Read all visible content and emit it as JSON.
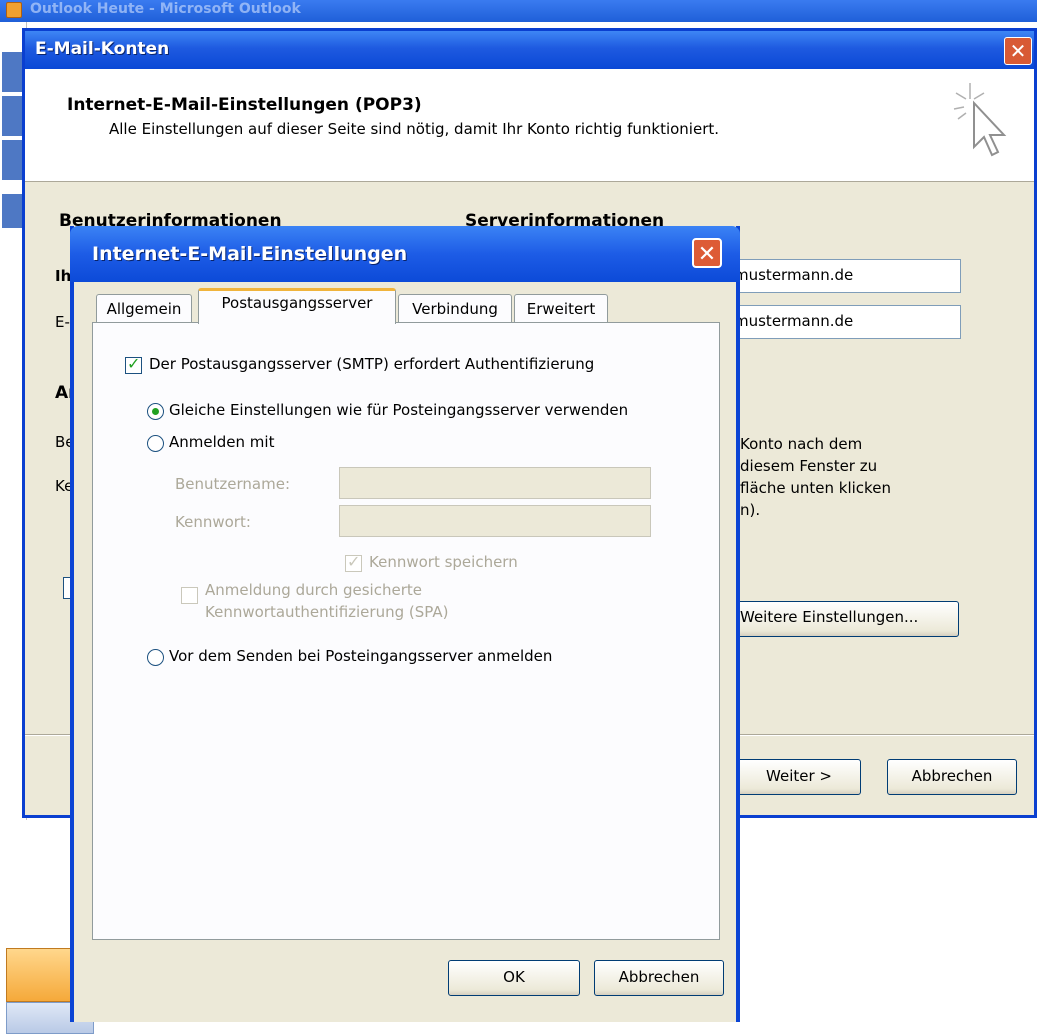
{
  "outlook": {
    "title": "Outlook Heute - Microsoft Outlook"
  },
  "email_accounts": {
    "title": "E-Mail-Konten",
    "header_title": "Internet-E-Mail-Einstellungen (POP3)",
    "header_subtitle": "Alle Einstellungen auf dieser Seite sind nötig, damit Ihr Konto richtig funktioniert.",
    "section_user": "Benutzerinformationen",
    "section_server": "Serverinformationen",
    "section_login_partial": "An",
    "label_name_partial": "Ih",
    "label_email_partial": "E-",
    "label_user_partial": "Be",
    "label_pw_partial": "Ke",
    "server_field_1": "mustermann.de",
    "server_field_2": "mustermann.de",
    "info_text_lines": [
      "Konto nach dem",
      "diesem Fenster zu",
      "fläche unten klicken",
      "n)."
    ],
    "more_settings_button": "Weitere Einstellungen...",
    "next_button": "Weiter >",
    "cancel_button": "Abbrechen"
  },
  "internet_settings": {
    "title": "Internet-E-Mail-Einstellungen",
    "tabs": [
      {
        "label": "Allgemein",
        "active": false
      },
      {
        "label": "Postausgangsserver",
        "active": true
      },
      {
        "label": "Verbindung",
        "active": false
      },
      {
        "label": "Erweitert",
        "active": false
      }
    ],
    "smtp_auth_checkbox": "Der Postausgangsserver (SMTP) erfordert Authentifizierung",
    "smtp_auth_checked": true,
    "radio_same_settings": "Gleiche Einstellungen wie für Posteingangsserver verwenden",
    "radio_login_with": "Anmelden mit",
    "username_label": "Benutzername:",
    "username_value": "",
    "password_label": "Kennwort:",
    "password_value": "",
    "save_password": "Kennwort speichern",
    "spa_line1": "Anmeldung durch gesicherte",
    "spa_line2": "Kennwortauthentifizierung (SPA)",
    "radio_pop_before_smtp": "Vor dem Senden bei Posteingangsserver anmelden",
    "ok_button": "OK",
    "cancel_button": "Abbrechen"
  }
}
